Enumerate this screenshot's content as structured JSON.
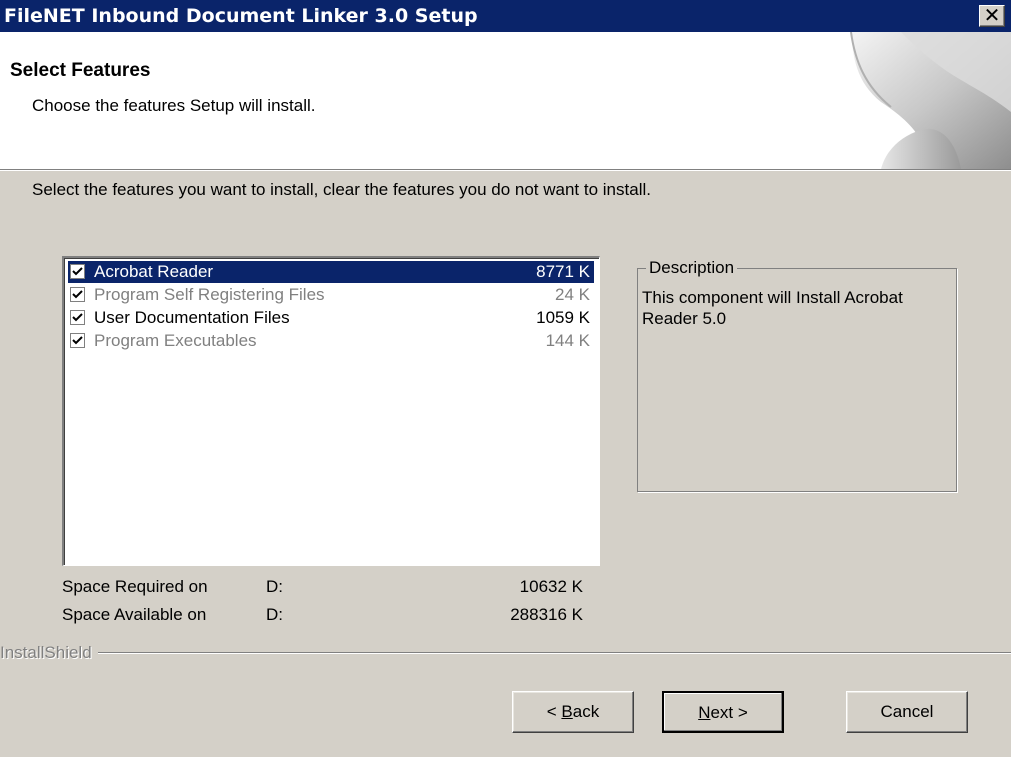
{
  "window": {
    "title": "FileNET Inbound Document Linker 3.0 Setup",
    "close_glyph": "✕"
  },
  "header": {
    "title": "Select Features",
    "subtitle": "Choose the features Setup will install."
  },
  "instruction": "Select the features you want to install, clear the features you do not want to install.",
  "features": [
    {
      "label": "Acrobat Reader",
      "size": "8771 K",
      "checked": true,
      "selected": true,
      "enabled": true
    },
    {
      "label": "Program Self Registering Files",
      "size": "24 K",
      "checked": true,
      "selected": false,
      "enabled": false
    },
    {
      "label": "User Documentation Files",
      "size": "1059 K",
      "checked": true,
      "selected": false,
      "enabled": true
    },
    {
      "label": "Program Executables",
      "size": "144 K",
      "checked": true,
      "selected": false,
      "enabled": false
    }
  ],
  "description": {
    "legend": "Description",
    "text": "This component will Install Acrobat Reader 5.0"
  },
  "space": {
    "required_label": "Space Required on",
    "required_drive": "D:",
    "required_value": "10632 K",
    "available_label": "Space Available on",
    "available_drive": "D:",
    "available_value": "288316 K"
  },
  "footer": {
    "brand": "InstallShield",
    "back_prefix": "< ",
    "back_key": "B",
    "back_rest": "ack",
    "next_key": "N",
    "next_rest": "ext >",
    "cancel_label": "Cancel"
  },
  "colors": {
    "titlebar": "#0a246a",
    "selection": "#0a246a",
    "disabled_text": "#808080",
    "dialog_face": "#d4d0c8"
  }
}
